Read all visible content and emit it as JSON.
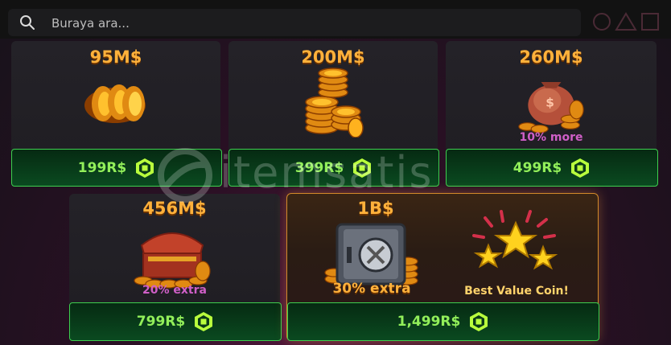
{
  "search": {
    "placeholder": "Buraya ara..."
  },
  "watermark": "itemsatis",
  "offers": [
    {
      "amount": "95M$",
      "price": "199R$"
    },
    {
      "amount": "200M$",
      "price": "399R$"
    },
    {
      "amount": "260M$",
      "price": "499R$",
      "badge": "10% more"
    },
    {
      "amount": "456M$",
      "price": "799R$",
      "badge": "20% extra"
    },
    {
      "amount": "1B$",
      "price": "1,499R$",
      "badge": "30% extra",
      "tag": "Best Value Coin!"
    }
  ],
  "icons": [
    "search-icon",
    "circle-icon",
    "triangle-icon",
    "square-icon",
    "robux-icon",
    "coin-stack-icon",
    "money-bag-icon",
    "treasure-chest-icon",
    "vault-icon",
    "stars-icon"
  ]
}
